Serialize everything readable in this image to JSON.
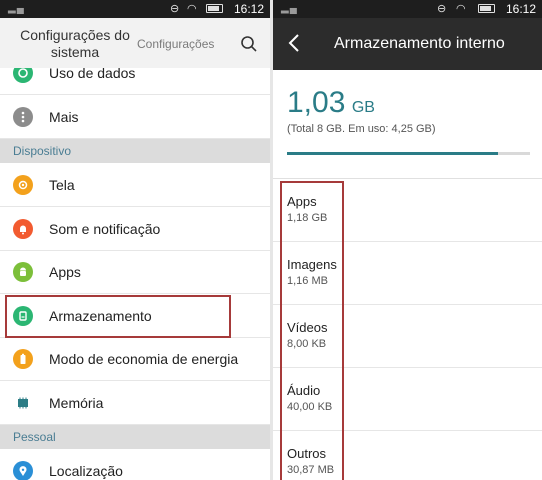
{
  "left": {
    "status": {
      "time": "16:12"
    },
    "header": {
      "title": "Configurações do sistema",
      "subtitle": "Configurações"
    },
    "rows_top": [
      {
        "label": "Uso de dados",
        "icon": "data-usage-icon",
        "color": "#2bb673"
      },
      {
        "label": "Mais",
        "icon": "more-icon",
        "color": "#8c8c8c"
      }
    ],
    "section_device": "Dispositivo",
    "rows_device": [
      {
        "label": "Tela",
        "icon": "display-icon",
        "color": "#f3a11c"
      },
      {
        "label": "Som e notificação",
        "icon": "bell-icon",
        "color": "#f25b30"
      },
      {
        "label": "Apps",
        "icon": "android-icon",
        "color": "#7cbf3a"
      },
      {
        "label": "Armazenamento",
        "icon": "storage-icon",
        "color": "#2bb673"
      },
      {
        "label": "Modo de economia de energia",
        "icon": "battery-icon",
        "color": "#f3a11c"
      },
      {
        "label": "Memória",
        "icon": "memory-icon",
        "color": "#2c7d86"
      }
    ],
    "section_personal": "Pessoal",
    "rows_personal": [
      {
        "label": "Localização",
        "icon": "location-icon",
        "color": "#2a8fd6"
      }
    ]
  },
  "right": {
    "status": {
      "time": "16:12"
    },
    "header": {
      "title": "Armazenamento interno"
    },
    "used_value": "1,03",
    "used_unit": "GB",
    "total_line": "(Total 8 GB. Em uso: 4,25 GB)",
    "progress_fraction": 0.87,
    "accent": "#2a7c87",
    "categories": [
      {
        "name": "Apps",
        "size": "1,18 GB"
      },
      {
        "name": "Imagens",
        "size": "1,16 MB"
      },
      {
        "name": "Vídeos",
        "size": "8,00 KB"
      },
      {
        "name": "Áudio",
        "size": "40,00 KB"
      },
      {
        "name": "Outros",
        "size": "30,87 MB"
      }
    ]
  },
  "highlight_color": "#a63a3a"
}
